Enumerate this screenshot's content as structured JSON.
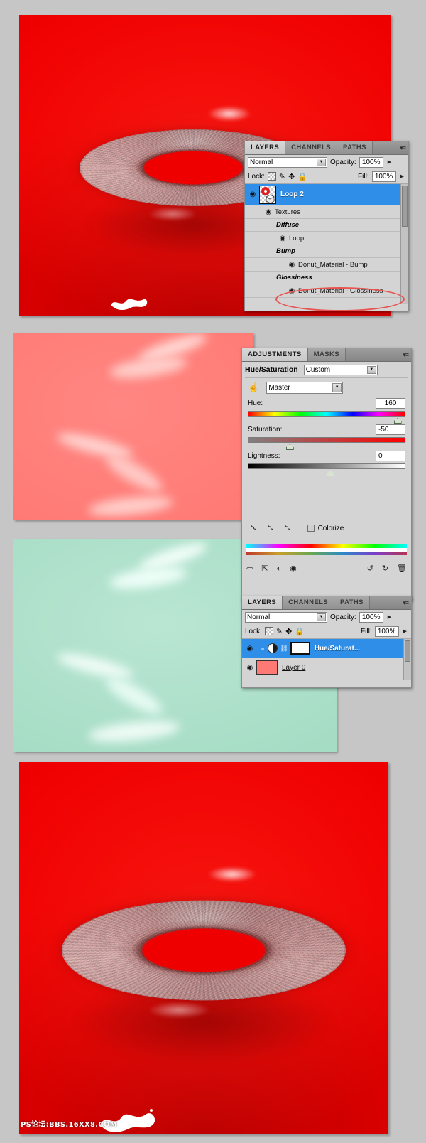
{
  "document": {
    "watermark": "PS论坛:BBS.16XX8.COM",
    "background_color": "#c6c6c6"
  },
  "images": {
    "top_render": {
      "name": "3d-donut-red-render-top",
      "bg_color": "#ef0000",
      "subject": "textured 3d torus donut"
    },
    "pink_texture": {
      "name": "pink-glossiness-texture",
      "bg_color": "#ff7a75"
    },
    "mint_texture": {
      "name": "mint-glossiness-texture",
      "bg_color": "#a5dcc4"
    },
    "bottom_render": {
      "name": "3d-donut-red-render-bottom",
      "bg_color": "#ef0000",
      "subject": "textured 3d torus donut"
    }
  },
  "layers_panel_top": {
    "tabs": [
      {
        "label": "LAYERS",
        "active": true
      },
      {
        "label": "CHANNELS",
        "active": false
      },
      {
        "label": "PATHS",
        "active": false
      }
    ],
    "menu_icon": "panel-menu-icon",
    "blend_mode": "Normal",
    "opacity_label": "Opacity:",
    "opacity_value": "100%",
    "lock_label": "Lock:",
    "lock_icons": [
      "lock-transparency-icon",
      "lock-image-icon",
      "lock-position-icon",
      "lock-all-icon"
    ],
    "fill_label": "Fill:",
    "fill_value": "100%",
    "rows": [
      {
        "name": "Loop 2",
        "type": "layer-3d",
        "selected": true,
        "visible": true,
        "indent": 0
      },
      {
        "name": "Textures",
        "type": "group",
        "selected": false,
        "visible": true,
        "indent": 1
      },
      {
        "name": "Diffuse",
        "type": "header",
        "selected": false,
        "visible": false,
        "indent": 2
      },
      {
        "name": "Loop",
        "type": "texture",
        "selected": false,
        "visible": true,
        "indent": 3
      },
      {
        "name": "Bump",
        "type": "header",
        "selected": false,
        "visible": false,
        "indent": 2
      },
      {
        "name": "Donut_Material - Bump",
        "type": "texture",
        "selected": false,
        "visible": true,
        "indent": 3
      },
      {
        "name": "Glossiness",
        "type": "header",
        "selected": false,
        "visible": false,
        "indent": 2
      },
      {
        "name": "Donut_Material - Glossiness",
        "type": "texture",
        "selected": false,
        "visible": true,
        "indent": 3
      }
    ],
    "annotation": {
      "shape": "ellipse",
      "color": "#e8534f",
      "targets": "Donut_Material - Glossiness"
    }
  },
  "adjustments_panel": {
    "tabs": [
      {
        "label": "ADJUSTMENTS",
        "active": true
      },
      {
        "label": "MASKS",
        "active": false
      }
    ],
    "menu_icon": "panel-menu-icon",
    "title": "Hue/Saturation",
    "preset": "Custom",
    "hand_tool_icon": "targeted-adjustment-icon",
    "channel": "Master",
    "sliders": [
      {
        "label": "Hue:",
        "value": "160",
        "knob_percent": 93
      },
      {
        "label": "Saturation:",
        "value": "-50",
        "knob_percent": 24
      },
      {
        "label": "Lightness:",
        "value": "0",
        "knob_percent": 50
      }
    ],
    "eyedroppers": [
      "eyedropper-icon",
      "eyedropper-add-icon",
      "eyedropper-subtract-icon"
    ],
    "colorize_label": "Colorize",
    "colorize_checked": false,
    "toolbar_icons": [
      "return-to-adjustment-list-icon",
      "clip-to-layer-icon",
      "preview-toggle-icon",
      "eye-visibility-icon",
      "reset-icon",
      "undo-icon",
      "delete-icon"
    ]
  },
  "layers_panel_bottom": {
    "tabs": [
      {
        "label": "LAYERS",
        "active": true
      },
      {
        "label": "CHANNELS",
        "active": false
      },
      {
        "label": "PATHS",
        "active": false
      }
    ],
    "menu_icon": "panel-menu-icon",
    "blend_mode": "Normal",
    "opacity_label": "Opacity:",
    "opacity_value": "100%",
    "lock_label": "Lock:",
    "fill_label": "Fill:",
    "fill_value": "100%",
    "rows": [
      {
        "name": "Hue/Saturat...",
        "type": "adjustment",
        "selected": true,
        "visible": true,
        "clipped": true
      },
      {
        "name": "Layer 0",
        "type": "pixel",
        "selected": false,
        "visible": true,
        "thumb_color": "#ff7a75"
      }
    ]
  },
  "colors": {
    "panel_bg": "#d4d4d4",
    "selection_blue": "#2f8fe8",
    "annotation_red": "#e8534f",
    "red_canvas": "#ef0000",
    "pink_canvas": "#ff7a75",
    "mint_canvas": "#a5dcc4"
  }
}
